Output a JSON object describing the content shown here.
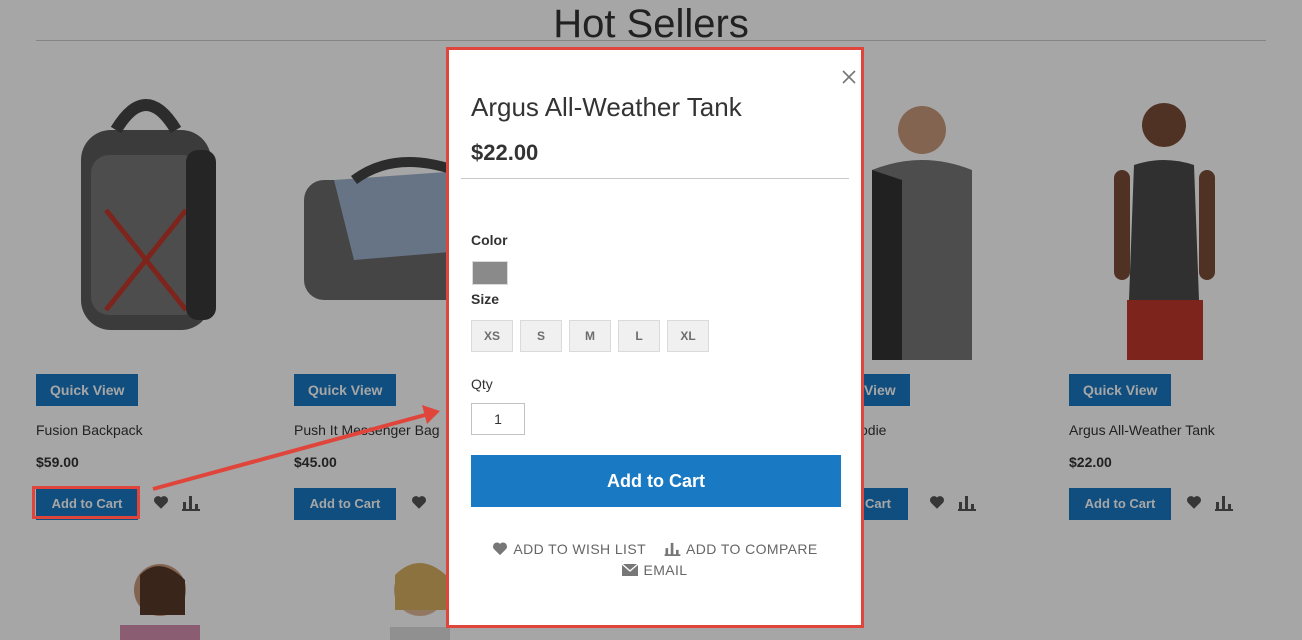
{
  "section_title": "Hot Sellers",
  "products": [
    {
      "name": "Fusion Backpack",
      "price": "$59.00",
      "quick_view": "Quick View",
      "add_to_cart": "Add to Cart"
    },
    {
      "name": "Push It Messenger Bag",
      "price": "$45.00",
      "quick_view": "Quick View",
      "add_to_cart": "Add to Cart"
    },
    {
      "name": "odie",
      "quick_view": "View",
      "add_to_cart": "Cart"
    },
    {
      "name": "Argus All-Weather Tank",
      "price": "$22.00",
      "quick_view": "Quick View",
      "add_to_cart": "Add to Cart"
    }
  ],
  "modal": {
    "title": "Argus All-Weather Tank",
    "price": "$22.00",
    "color_label": "Color",
    "selected_color": "#8a8a8a",
    "size_label": "Size",
    "sizes": [
      "XS",
      "S",
      "M",
      "L",
      "XL"
    ],
    "qty_label": "Qty",
    "qty_value": "1",
    "add_to_cart": "Add to Cart",
    "wish_list": "ADD TO WISH LIST",
    "compare": "ADD TO COMPARE",
    "email": "EMAIL"
  },
  "colors": {
    "accent": "#1979c3",
    "highlight": "#e0453b"
  }
}
